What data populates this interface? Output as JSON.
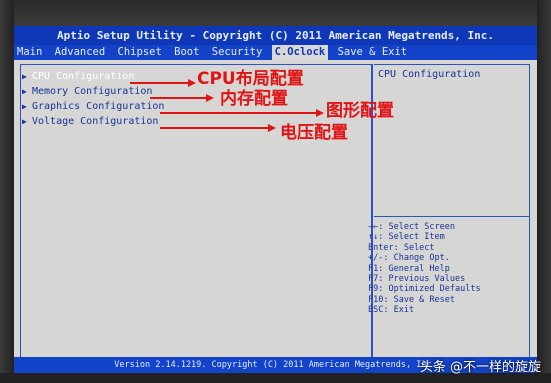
{
  "title": "Aptio Setup Utility - Copyright (C) 2011 American Megatrends, Inc.",
  "menu": [
    "Main",
    "Advanced",
    "Chipset",
    "Boot",
    "Security",
    "C.Oclock",
    "Save & Exit"
  ],
  "active_menu": "C.Oclock",
  "items": [
    {
      "label": "CPU Configuration",
      "annotation": "CPU布局配置"
    },
    {
      "label": "Memory Configuration",
      "annotation": "内存配置"
    },
    {
      "label": "Graphics Configuration",
      "annotation": "图形配置"
    },
    {
      "label": "Voltage Configuration",
      "annotation": "电压配置"
    }
  ],
  "help_title": "CPU Configuration",
  "keys": [
    "→←: Select Screen",
    "↑↓: Select Item",
    "Enter: Select",
    "+/-: Change Opt.",
    "F1: General Help",
    "F7: Previous Values",
    "F9: Optimized Defaults",
    "F10: Save & Reset",
    "ESC: Exit"
  ],
  "footer": "Version 2.14.1219. Copyright (C) 2011 American Megatrends, Inc.",
  "watermark": "头条 @不一样的旋旋",
  "colors": {
    "bios_blue": "#1243c8",
    "bios_grey": "#d6d6d4",
    "annotation_red": "#e01414"
  }
}
